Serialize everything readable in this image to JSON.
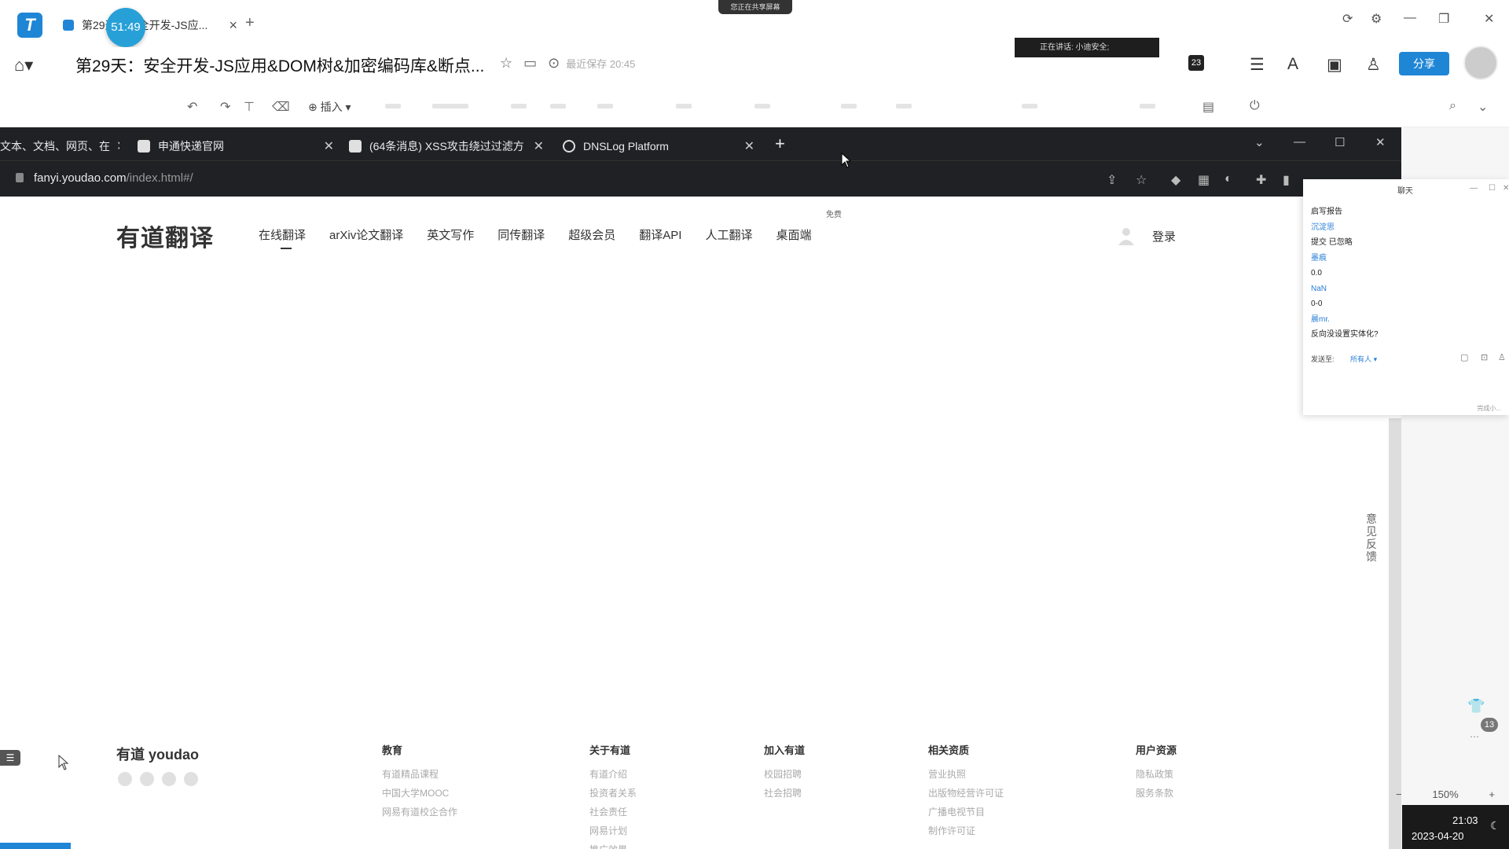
{
  "doc_app": {
    "tab_title": "第29天：安全开发-JS应...",
    "timer": "51:49",
    "share_banner": "您正在共享屏幕",
    "doc_title": "第29天：安全开发-JS应用&DOM树&加密编码库&断点...",
    "saved_status": "最近保存 20:45",
    "speaking": "正在讲话: 小迪安全;",
    "badge_count": "23",
    "share_label": "分享",
    "insert_label": "插入"
  },
  "browser": {
    "tabs": [
      {
        "title": "文本、文档、网页、在",
        "icon_color": "#202124"
      },
      {
        "title": "申通快递官网",
        "icon_color": "#e0e0e0"
      },
      {
        "title": "(64条消息) XSS攻击绕过过滤方",
        "icon_color": "#e0e0e0"
      },
      {
        "title": "DNSLog Platform",
        "icon_color": "#202124"
      }
    ],
    "url_domain": "fanyi.youdao.com",
    "url_rest": "/index.html#/"
  },
  "youdao": {
    "logo": "有道翻译",
    "nav": [
      "在线翻译",
      "arXiv论文翻译",
      "英文写作",
      "同传翻译",
      "超级会员",
      "翻译API",
      "人工翻译",
      "桌面端"
    ],
    "free_tag": "免费",
    "login": "登录",
    "feedback": "意见反馈",
    "footer_logo": "有道 youdao",
    "footer_cols": [
      {
        "title": "教育",
        "links": [
          "有道精品课程",
          "中国大学MOOC",
          "网易有道校企合作"
        ]
      },
      {
        "title": "关于有道",
        "links": [
          "有道介绍",
          "投资者关系",
          "社会责任",
          "网易计划",
          "推广效果"
        ]
      },
      {
        "title": "加入有道",
        "links": [
          "校园招聘",
          "社会招聘"
        ]
      },
      {
        "title": "相关资质",
        "links": [
          "营业执照",
          "出版物经营许可证",
          "广播电视节目",
          "制作许可证"
        ]
      },
      {
        "title": "用户资源",
        "links": [
          "隐私政策",
          "服务条款"
        ]
      }
    ]
  },
  "chat": {
    "title": "聊天",
    "messages": [
      {
        "text": "启写报告",
        "blue": false
      },
      {
        "text": "沉淀思",
        "blue": true
      },
      {
        "text": "提交 已忽略",
        "blue": false
      },
      {
        "text": "墨痕",
        "blue": true
      },
      {
        "text": "0.0",
        "blue": false
      },
      {
        "text": "NaN",
        "blue": true
      },
      {
        "text": "0-0",
        "blue": false
      },
      {
        "text": "晨mr.",
        "blue": true
      },
      {
        "text": "反向没设置实体化?",
        "blue": false
      }
    ],
    "send_label": "发送至:",
    "send_to": "所有人",
    "footer": "完成小..."
  },
  "widgets": {
    "badge": "13",
    "zoom": "150%",
    "time": "21:03",
    "date": "2023-04-20"
  }
}
